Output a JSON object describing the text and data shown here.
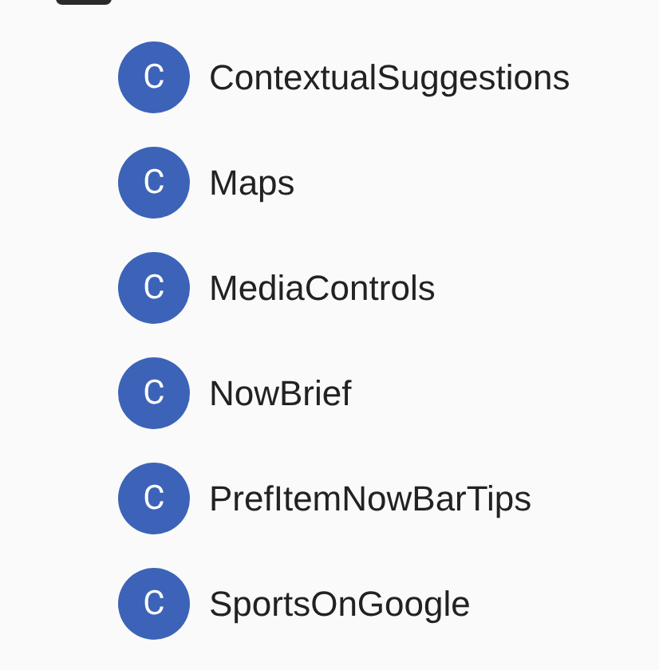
{
  "items": [
    {
      "letter": "C",
      "label": "ContextualSuggestions"
    },
    {
      "letter": "C",
      "label": "Maps"
    },
    {
      "letter": "C",
      "label": "MediaControls"
    },
    {
      "letter": "C",
      "label": "NowBrief"
    },
    {
      "letter": "C",
      "label": "PrefItemNowBarTips"
    },
    {
      "letter": "C",
      "label": "SportsOnGoogle"
    }
  ]
}
